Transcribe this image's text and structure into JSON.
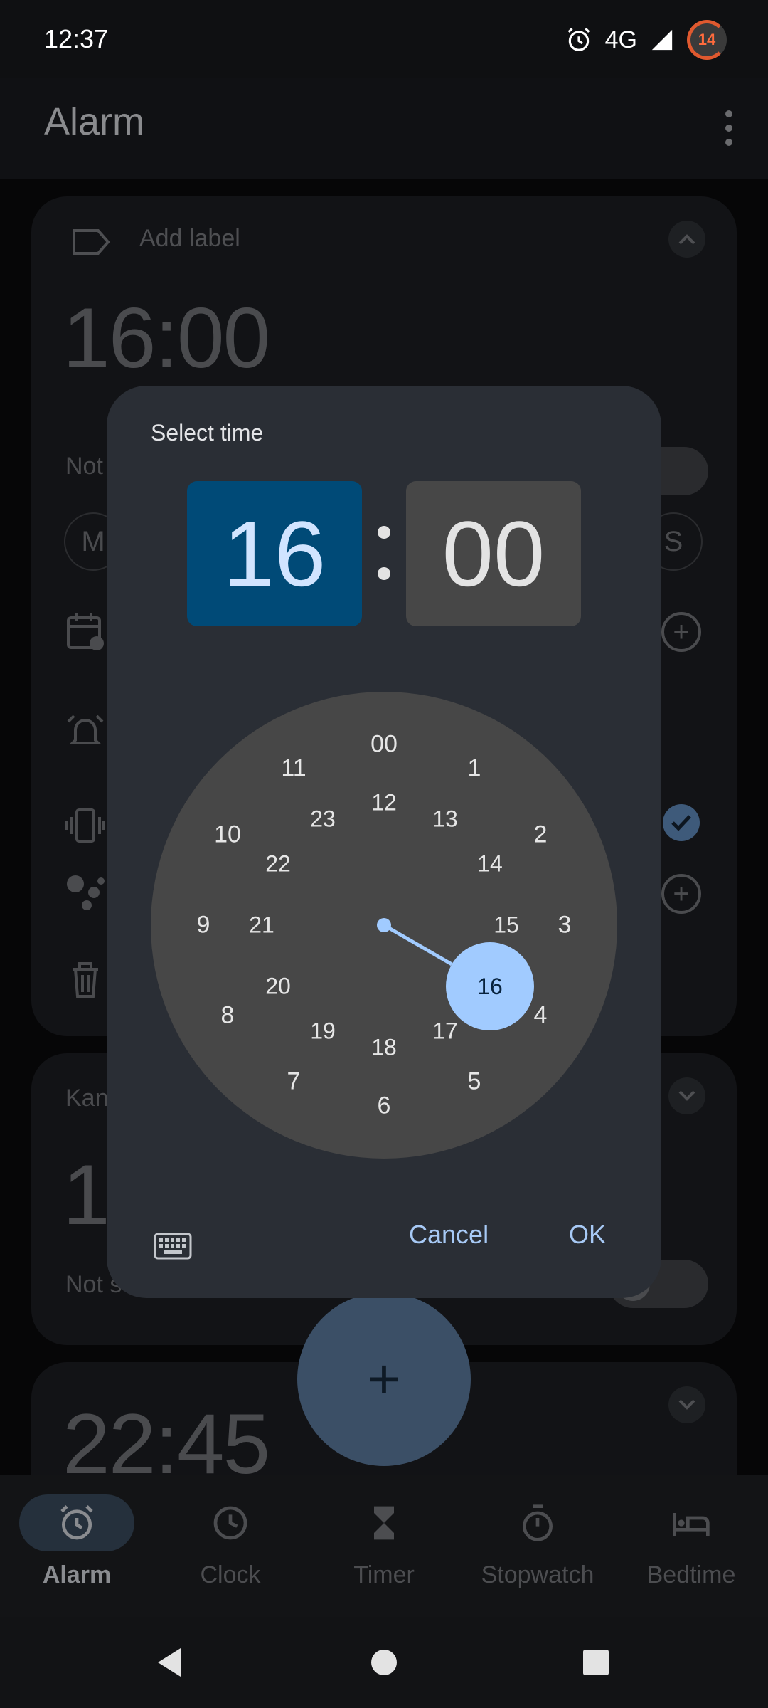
{
  "status": {
    "time": "12:37",
    "network": "4G",
    "battery": "14"
  },
  "app": {
    "title": "Alarm"
  },
  "cards": {
    "card1": {
      "add_label": "Add label",
      "time": "16:00",
      "status_partial": "Not",
      "day_left": "M",
      "day_right": "S"
    },
    "card2": {
      "label_partial": "Kan",
      "time_partial": "1",
      "status": "Not scheduled"
    },
    "card3": {
      "time": "22:45"
    }
  },
  "fab": {
    "symbol": "+"
  },
  "dialog": {
    "title": "Select time",
    "hour": "16",
    "minute": "00",
    "separator": ":",
    "cancel": "Cancel",
    "ok": "OK",
    "dial": {
      "selected": "16",
      "outer": [
        "00",
        "1",
        "2",
        "3",
        "4",
        "5",
        "6",
        "7",
        "8",
        "9",
        "10",
        "11"
      ],
      "inner": [
        "12",
        "13",
        "14",
        "15",
        "16",
        "17",
        "18",
        "19",
        "20",
        "21",
        "22",
        "23"
      ]
    }
  },
  "nav": {
    "items": [
      {
        "label": "Alarm",
        "icon": "alarm-icon",
        "active": true
      },
      {
        "label": "Clock",
        "icon": "clock-icon",
        "active": false
      },
      {
        "label": "Timer",
        "icon": "hourglass-icon",
        "active": false
      },
      {
        "label": "Stopwatch",
        "icon": "stopwatch-icon",
        "active": false
      },
      {
        "label": "Bedtime",
        "icon": "bed-icon",
        "active": false
      }
    ]
  },
  "colors": {
    "accent": "#a1cbff",
    "hour_box": "#004a77",
    "dialog_bg": "#2a2e35",
    "dial_bg": "#474747"
  }
}
